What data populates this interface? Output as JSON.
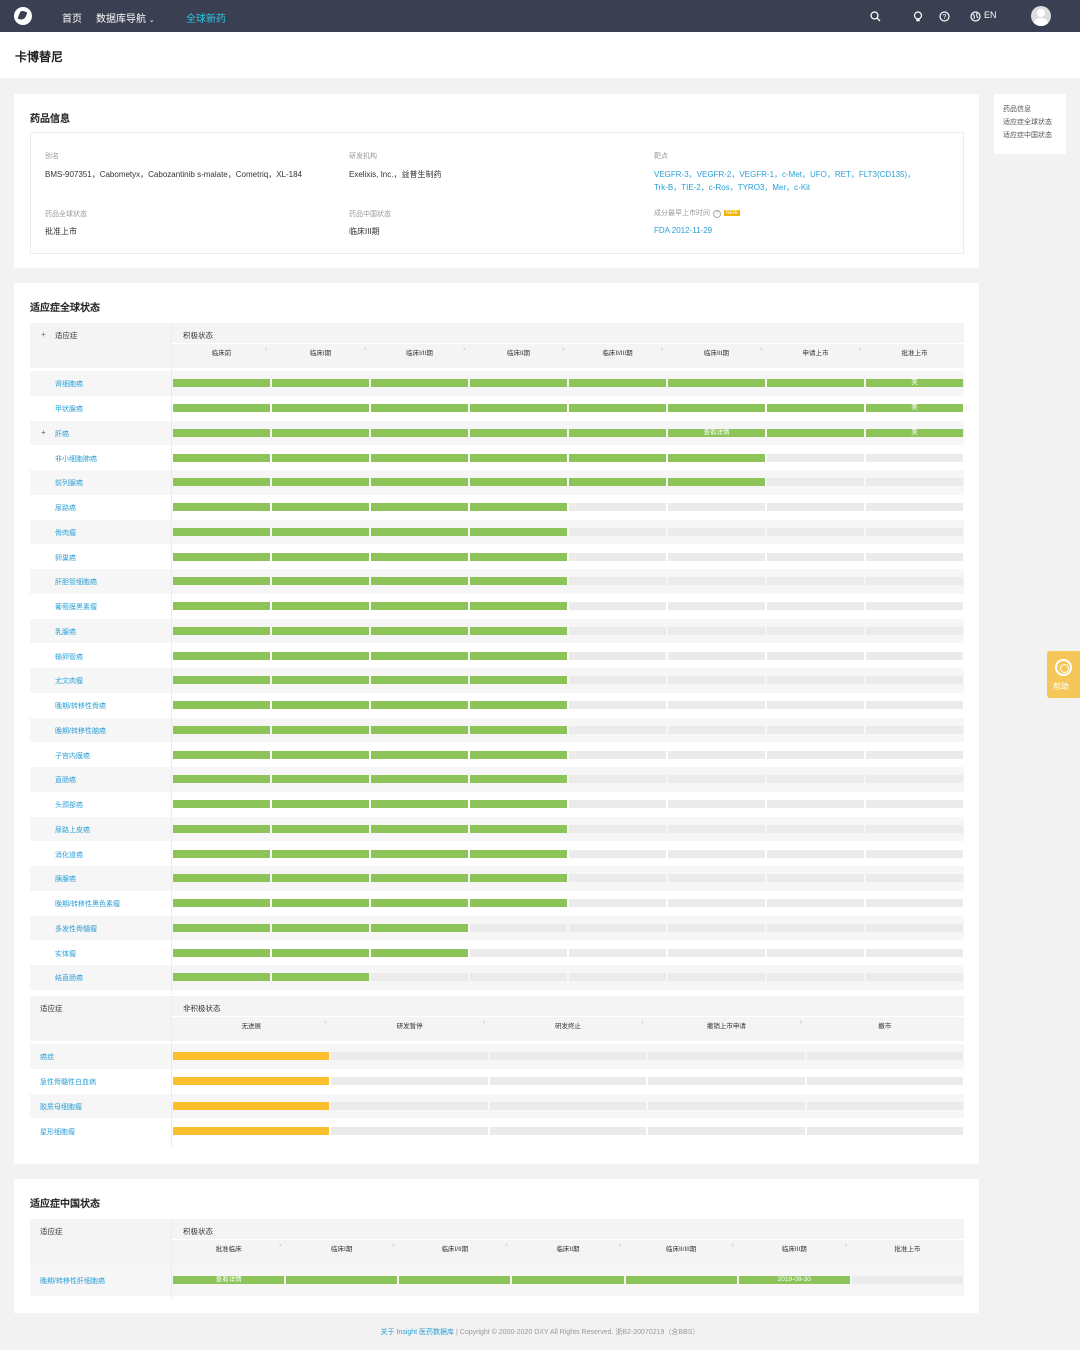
{
  "nav": {
    "home": "首页",
    "db_nav": "数据库导航",
    "global_drugs": "全球新药",
    "lang": "EN"
  },
  "page": {
    "title": "卡博替尼"
  },
  "drug_info": {
    "section_title": "药品信息",
    "alias_label": "别名",
    "alias_value": "BMS-907351，Cabometyx，Cabozantinib s-malate，Cometriq，XL-184",
    "org_label": "研发机构",
    "org_value": "Exelixis, Inc.，益普生制药",
    "target_label": "靶点",
    "targets_line1": "VEGFR-3，VEGFR-2，VEGFR-1，c-Met，UFO，RET，FLT3(CD135)，",
    "targets_line2": "Trk-B，TIE-2，c-Ros，TYRO3，Mer，c-Kit",
    "global_status_label": "药品全球状态",
    "global_status_value": "批准上市",
    "china_status_label": "药品中国状态",
    "china_status_value": "临床III期",
    "first_approval_label": "成分最早上市时间",
    "new_badge": "NEW",
    "first_approval_value": "FDA 2012-11-29"
  },
  "side_nav": {
    "items": [
      "药品信息",
      "适应症全球状态",
      "适应症中国状态"
    ]
  },
  "help": {
    "label": "帮助"
  },
  "global_section": {
    "title": "适应症全球状态",
    "indication_header": "适应症",
    "active_header": "积极状态",
    "stages": [
      "临床前",
      "临床I期",
      "临床I/II期",
      "临床II期",
      "临床II/III期",
      "临床III期",
      "申请上市",
      "批准上市"
    ],
    "rows": [
      {
        "name": "肾细胞癌",
        "progress": 8,
        "approved_label": "美"
      },
      {
        "name": "甲状腺癌",
        "progress": 8,
        "approved_label": "美"
      },
      {
        "name": "肝癌",
        "progress": 8,
        "approved_label": "美",
        "detail_label": "查看详情",
        "expandable": true
      },
      {
        "name": "非小细胞肺癌",
        "progress": 6
      },
      {
        "name": "前列腺癌",
        "progress": 6
      },
      {
        "name": "尿路癌",
        "progress": 4
      },
      {
        "name": "骨肉瘤",
        "progress": 4
      },
      {
        "name": "卵巢癌",
        "progress": 4
      },
      {
        "name": "肝胆管细胞癌",
        "progress": 4
      },
      {
        "name": "葡萄膜黑素瘤",
        "progress": 4
      },
      {
        "name": "乳腺癌",
        "progress": 4
      },
      {
        "name": "输卵管癌",
        "progress": 4
      },
      {
        "name": "尤文肉瘤",
        "progress": 4
      },
      {
        "name": "晚期/转移性骨癌",
        "progress": 4
      },
      {
        "name": "晚期/转移性脑癌",
        "progress": 4
      },
      {
        "name": "子宫内膜癌",
        "progress": 4
      },
      {
        "name": "直肠癌",
        "progress": 4
      },
      {
        "name": "头颈部癌",
        "progress": 4
      },
      {
        "name": "尿路上皮癌",
        "progress": 4
      },
      {
        "name": "消化道癌",
        "progress": 4
      },
      {
        "name": "胰腺癌",
        "progress": 4
      },
      {
        "name": "晚期/转移性黑色素瘤",
        "progress": 4
      },
      {
        "name": "多发性骨髓瘤",
        "progress": 3
      },
      {
        "name": "实体瘤",
        "progress": 3
      },
      {
        "name": "结直肠癌",
        "progress": 2
      }
    ],
    "inactive_header": "非积极状态",
    "inactive_stages": [
      "无进展",
      "研发暂停",
      "研发终止",
      "撤销上市申请",
      "撤市"
    ],
    "inactive_rows": [
      {
        "name": "癌症",
        "progress": 1
      },
      {
        "name": "急性骨髓性白血病",
        "progress": 1
      },
      {
        "name": "胶质母细胞瘤",
        "progress": 1
      },
      {
        "name": "星形细胞瘤",
        "progress": 1
      }
    ]
  },
  "china_section": {
    "title": "适应症中国状态",
    "indication_header": "适应症",
    "active_header": "积极状态",
    "stages": [
      "批准临床",
      "临床I期",
      "临床I/II期",
      "临床II期",
      "临床II/III期",
      "临床III期",
      "批准上市"
    ],
    "rows": [
      {
        "name": "晚期/转移性肝细胞癌",
        "progress": 6,
        "detail_label": "查看详情",
        "date_label": "2019-09-30"
      }
    ]
  },
  "footer": {
    "about": "关于 Insight 医药数据库",
    "copyright": " | Copyright © 2000-2020 DXY All Rights Reserved. 浙B2-20070219（含BBS）"
  },
  "colors": {
    "active_bar": "#8cc45a",
    "inactive_bar": "#fbbf2d",
    "link": "#2a9fd6",
    "nav_bg": "#3a3f51"
  }
}
